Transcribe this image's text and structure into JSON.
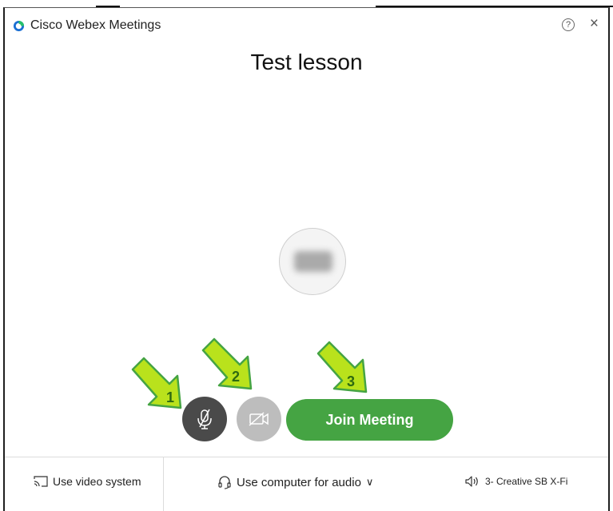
{
  "window": {
    "title": "Cisco Webex Meetings",
    "help_symbol": "?",
    "close_symbol": "×"
  },
  "meeting": {
    "title": "Test lesson"
  },
  "controls": {
    "mute_icon": "microphone-muted-icon",
    "video_icon": "video-off-icon",
    "join_label": "Join Meeting"
  },
  "annotations": [
    {
      "number": "1",
      "points_to": "mute-button"
    },
    {
      "number": "2",
      "points_to": "video-button"
    },
    {
      "number": "3",
      "points_to": "join-meeting-button"
    }
  ],
  "footer": {
    "video_system_label": "Use video system",
    "audio_label": "Use computer for audio",
    "audio_dropdown_symbol": "∨",
    "speaker_label": "3- Creative SB X-Fi"
  },
  "colors": {
    "join": "#45a443",
    "mute": "#4a4a4a",
    "video": "#bdbdbd",
    "arrow_fill": "#b9e21c",
    "arrow_stroke": "#45a443",
    "logo_blue": "#1a6fd3"
  }
}
